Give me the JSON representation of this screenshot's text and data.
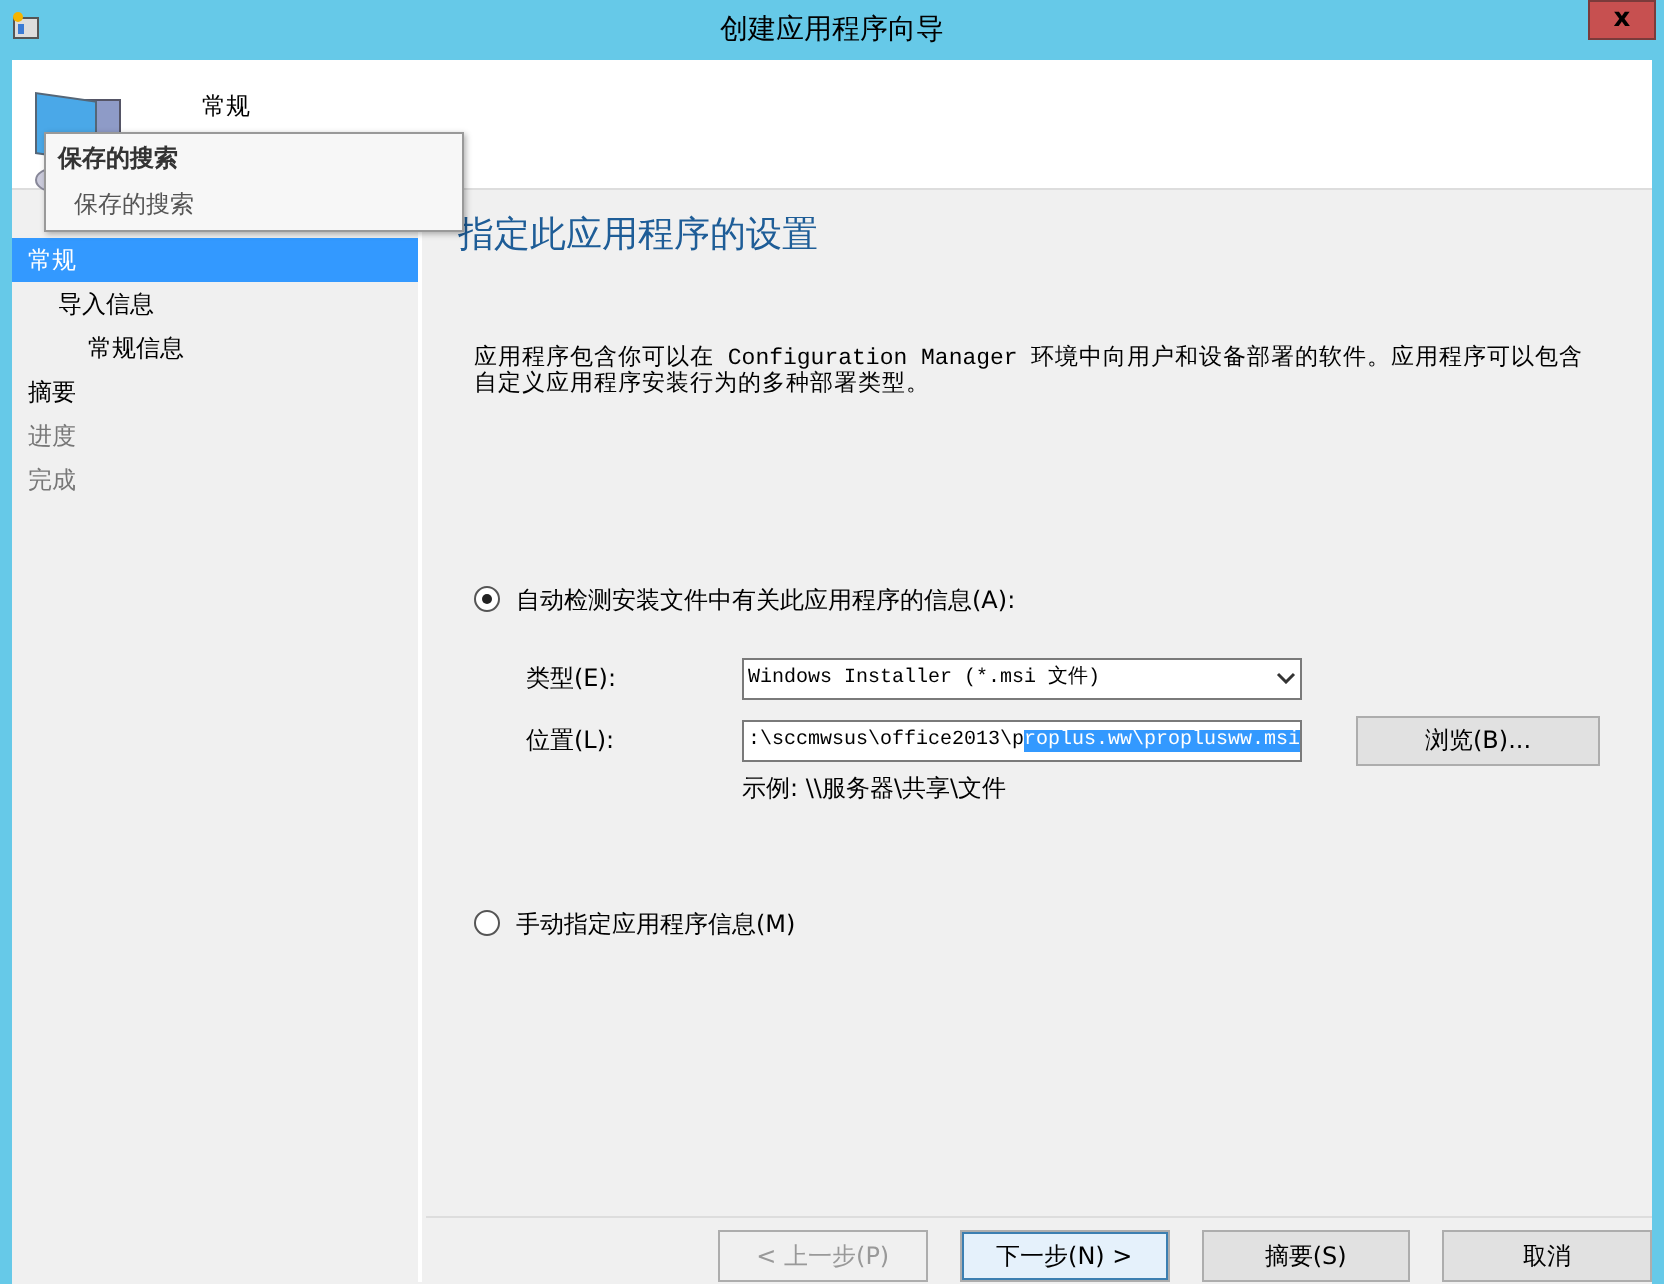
{
  "window": {
    "title": "创建应用程序向导",
    "close": "x"
  },
  "header": {
    "title": "常规"
  },
  "tooltip": {
    "title": "保存的搜索",
    "text": "保存的搜索"
  },
  "nav": [
    {
      "label": "常规",
      "selected": true,
      "disabled": false,
      "children": [
        {
          "label": "导入信息",
          "selected": false,
          "disabled": false,
          "children": [
            {
              "label": "常规信息",
              "selected": false,
              "disabled": false
            }
          ]
        }
      ]
    },
    {
      "label": "摘要",
      "selected": false,
      "disabled": false
    },
    {
      "label": "进度",
      "selected": false,
      "disabled": true
    },
    {
      "label": "完成",
      "selected": false,
      "disabled": true
    }
  ],
  "page": {
    "heading": "指定此应用程序的设置",
    "description": "应用程序包含你可以在 Configuration Manager 环境中向用户和设备部署的软件。应用程序可以包含自定义应用程序安装行为的多种部署类型。"
  },
  "options": [
    {
      "label": "自动检测安装文件中有关此应用程序的信息(A):",
      "selected": true
    },
    {
      "label": "手动指定应用程序信息(M)",
      "selected": false
    }
  ],
  "type_field": {
    "label": "类型(E):",
    "value": "Windows Installer (*.msi 文件)"
  },
  "location_field": {
    "label": "位置(L):",
    "value": ":\\sccmwsus\\office2013\\p",
    "selection": "roplus.ww\\proplusww.msi",
    "browse": "浏览(B)...",
    "example": "示例: \\\\服务器\\共享\\文件"
  },
  "buttons": [
    {
      "label": "< 上一步(P)",
      "disabled": true,
      "selected": false
    },
    {
      "label": "下一步(N) >",
      "disabled": false,
      "selected": true
    },
    {
      "label": "摘要(S)",
      "disabled": false,
      "selected": false
    },
    {
      "label": "取消",
      "disabled": false,
      "selected": false
    }
  ]
}
